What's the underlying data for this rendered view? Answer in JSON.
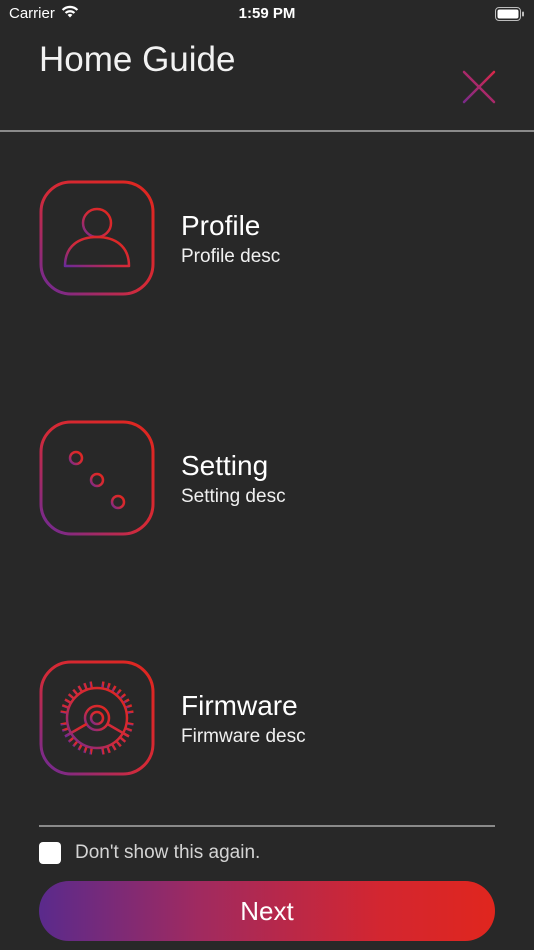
{
  "status_bar": {
    "carrier": "Carrier",
    "time": "1:59 PM"
  },
  "header": {
    "title": "Home Guide"
  },
  "items": [
    {
      "icon": "profile-icon",
      "title": "Profile",
      "desc": "Profile desc"
    },
    {
      "icon": "sliders-icon",
      "title": "Setting",
      "desc": "Setting desc"
    },
    {
      "icon": "firmware-gear-icon",
      "title": "Firmware",
      "desc": "Firmware desc"
    }
  ],
  "footer": {
    "dont_show_label": "Don't show this again.",
    "dont_show_checked": false,
    "next_label": "Next"
  },
  "colors": {
    "background": "#282828",
    "accent_red": "#e0261e",
    "accent_purple": "#5a2a8c"
  }
}
